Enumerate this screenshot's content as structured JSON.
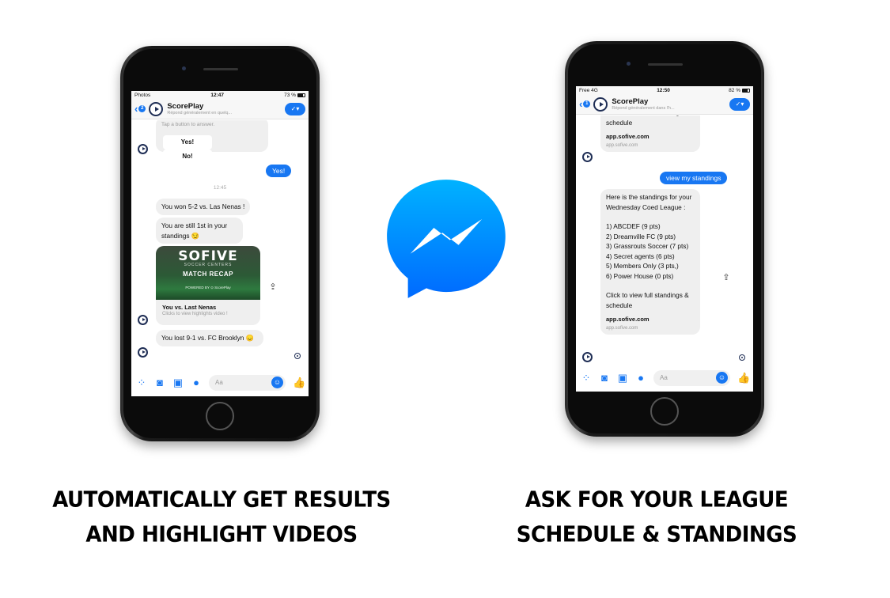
{
  "left_phone": {
    "status": {
      "left": "Photos",
      "time": "12:47",
      "battery": "73 %"
    },
    "header": {
      "back_badge": "2",
      "name": "ScorePlay",
      "subtitle": "Répond généralement en quelq..."
    },
    "quick_reply_prompt": "Tap a button to answer.",
    "quick_yes": "Yes!",
    "quick_no": "No!",
    "sent_yes": "Yes!",
    "timestamp": "12:45",
    "msg_won": "You won 5-2 vs. Las Nenas !",
    "msg_first": "You are still 1st in your standings 😏",
    "card": {
      "logo": "SOFIVE",
      "logo_sub": "SOCCER CENTERS",
      "banner": "MATCH RECAP",
      "powered": "POWERED BY ⊙ ScorePlay",
      "title": "You vs. Last Nenas",
      "subtitle": "Clicks to view highlights video !"
    },
    "msg_lost": "You lost 9-1 vs. FC Brooklyn 😞",
    "composer_placeholder": "Aa"
  },
  "right_phone": {
    "status": {
      "left": "Free 4G",
      "time": "12:50",
      "battery": "82 %"
    },
    "header": {
      "back_badge": "1",
      "name": "ScorePlay",
      "subtitle": "Répond généralement dans l'h..."
    },
    "top_bubble": {
      "text": "Click to view full standings & schedule",
      "link_title": "app.sofive.com",
      "link_url": "app.sofive.com"
    },
    "sent": "view my standings",
    "standings_bubble": {
      "intro": "Here is the standings for your Wednesday Coed League :",
      "rows": [
        "1) ABCDEF (9 pts)",
        "2) Dreamville FC (9 pts)",
        "3) Grassrouts Soccer (7 pts)",
        "4) Secret agents (6 pts)",
        "5) Members Only (3 pts,)",
        "6) Power House (0 pts)"
      ],
      "footer": "Click to view full standings & schedule",
      "link_title": "app.sofive.com",
      "link_url": "app.sofive.com"
    },
    "composer_placeholder": "Aa"
  },
  "captions": {
    "left_line1": "AUTOMATICALLY GET RESULTS",
    "left_line2": "AND HIGHLIGHT VIDEOS",
    "right_line1": "ASK FOR YOUR LEAGUE",
    "right_line2": "SCHEDULE & STANDINGS"
  },
  "colors": {
    "messenger_blue": "#1877f2",
    "avatar_navy": "#1f2e55"
  }
}
